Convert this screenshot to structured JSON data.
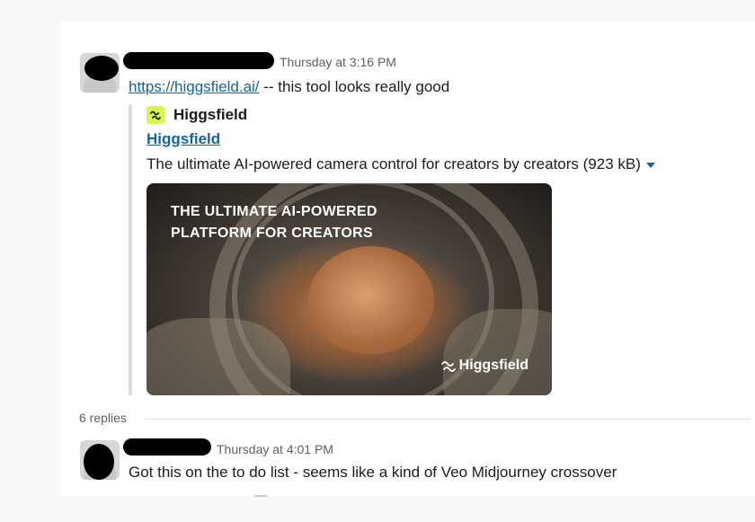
{
  "messages": [
    {
      "timestamp": "Thursday at 3:16 PM",
      "link_text": "https://higgsfield.ai/",
      "text": " -- this tool looks really good",
      "unfurl": {
        "site_name": "Higgsfield",
        "title": "Higgsfield",
        "description": "The ultimate AI-powered camera control for creators by creators (923 kB)",
        "image_headline_line1": "THE ULTIMATE AI-POWERED",
        "image_headline_line2": "PLATFORM FOR CREATORS",
        "image_brand": "Higgsfield"
      }
    },
    {
      "timestamp": "Thursday at 4:01 PM",
      "text": "Got this on the to do list - seems like a kind of Veo Midjourney crossover"
    }
  ],
  "thread": {
    "replies_label": "6 replies"
  },
  "colors": {
    "link": "#1264a3",
    "favicon_bg": "#d4f94a",
    "meta_text": "#616061"
  },
  "icons": [
    "higgsfield-logo-icon",
    "caret-down-icon"
  ]
}
